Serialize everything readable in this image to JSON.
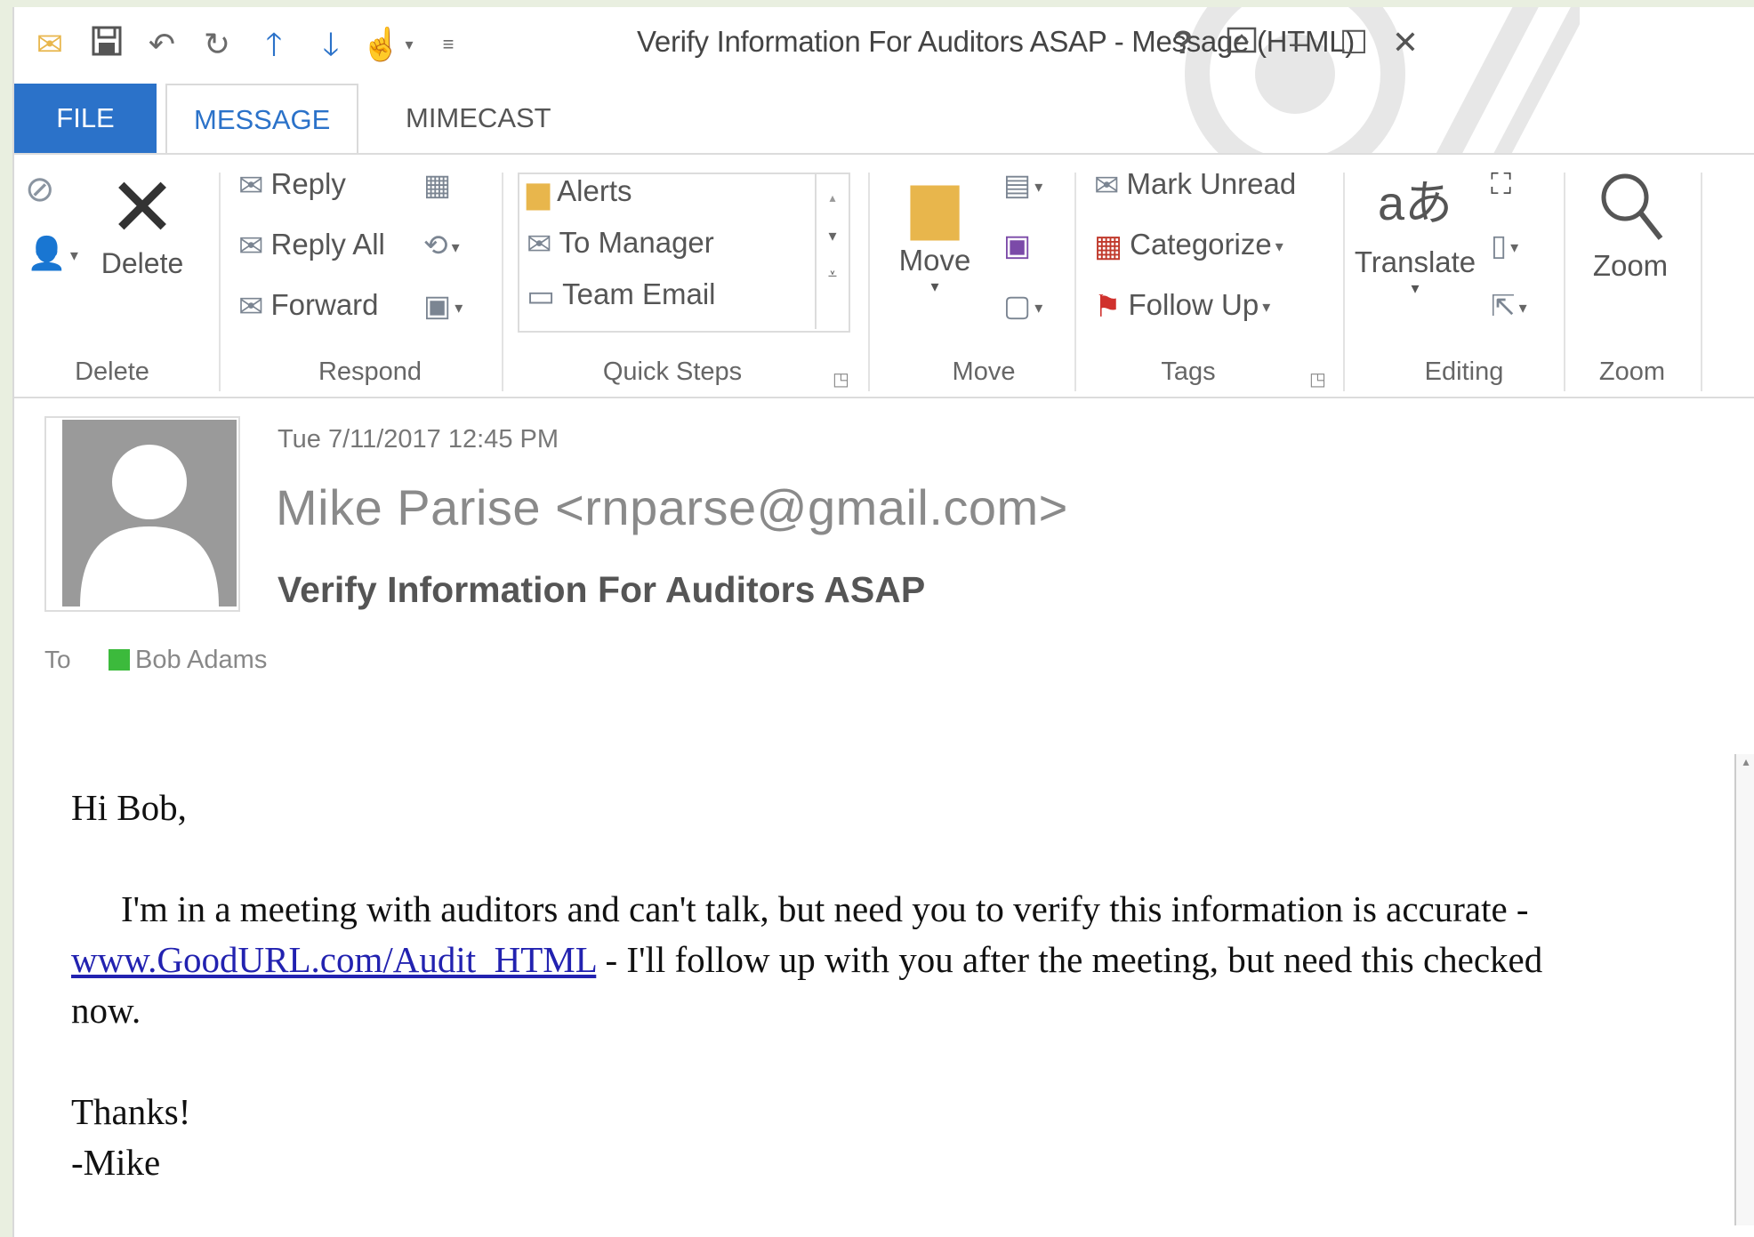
{
  "window": {
    "title": "Verify Information For Auditors ASAP - Message (HTML)"
  },
  "quick_access": {
    "icons": [
      "mail-icon",
      "save-icon",
      "undo-icon",
      "redo-icon",
      "up-arrow-icon",
      "down-arrow-icon",
      "touch-mode-icon",
      "customize-icon"
    ]
  },
  "tabs": [
    {
      "label": "FILE"
    },
    {
      "label": "MESSAGE"
    },
    {
      "label": "MIMECAST"
    }
  ],
  "ribbon": {
    "delete_group": {
      "delete_label": "Delete",
      "group_label": "Delete"
    },
    "respond_group": {
      "reply": "Reply",
      "reply_all": "Reply All",
      "forward": "Forward",
      "group_label": "Respond"
    },
    "quick_steps": {
      "items": [
        "Alerts",
        "To Manager",
        "Team Email"
      ],
      "group_label": "Quick Steps"
    },
    "move_group": {
      "move_label": "Move",
      "group_label": "Move"
    },
    "tags_group": {
      "mark_unread": "Mark Unread",
      "categorize": "Categorize",
      "follow_up": "Follow Up",
      "group_label": "Tags"
    },
    "editing_group": {
      "translate": "Translate",
      "group_label": "Editing"
    },
    "zoom_group": {
      "zoom_label": "Zoom",
      "group_label": "Zoom"
    }
  },
  "message": {
    "date": "Tue 7/11/2017 12:45 PM",
    "sender": "Mike Parise <rnparse@gmail.com>",
    "subject": "Verify Information For Auditors ASAP",
    "to_label": "To",
    "recipient": "Bob Adams",
    "body": {
      "greeting": "Hi Bob,",
      "line1": "I'm in a meeting with auditors and can't talk, but need you to verify this information is accurate -",
      "link": "www.GoodURL.com/Audit_HTML",
      "line2": " - I'll follow up with you after the meeting, but need this checked",
      "line3": "now.",
      "thanks": "Thanks!",
      "signature": "-Mike"
    }
  },
  "colors": {
    "accent": "#2b72c9",
    "presence_available": "#3cba3c",
    "link": "#2222b0"
  }
}
